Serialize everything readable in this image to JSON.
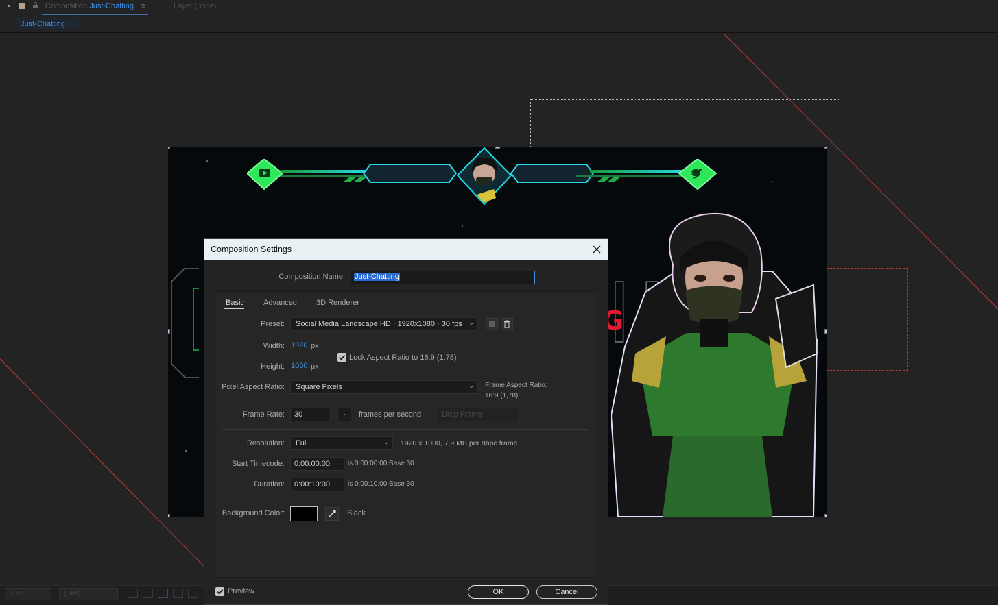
{
  "panel": {
    "close_glyph": "×",
    "comp_prefix": "Composition",
    "comp_name": "Just-Chatting",
    "menu_glyph": "≡",
    "layer_tab": "Layer (none)",
    "comp_chip": "Just-Chatting"
  },
  "viewer": {
    "zoom": "50%",
    "resolution": "(Half)"
  },
  "dialog": {
    "title": "Composition Settings",
    "name_label": "Composition Name:",
    "name_value": "Just-Chatting",
    "tabs": [
      "Basic",
      "Advanced",
      "3D Renderer"
    ],
    "preset_label": "Preset:",
    "preset_value": "Social Media Landscape HD  ·  1920x1080 · 30 fps",
    "width_label": "Width:",
    "width_value": "1920",
    "width_unit": "px",
    "height_label": "Height:",
    "height_value": "1080",
    "height_unit": "px",
    "lock_label": "Lock Aspect Ratio to 16:9 (1,78)",
    "lock_checked": true,
    "par_label": "Pixel Aspect Ratio:",
    "par_value": "Square Pixels",
    "far_label": "Frame Aspect Ratio:",
    "far_value": "16:9 (1,78)",
    "fps_label": "Frame Rate:",
    "fps_value": "30",
    "fps_unit": "frames per second",
    "drop_frame": "Drop Frame",
    "res_label": "Resolution:",
    "res_value": "Full",
    "res_info": "1920 x 1080, 7,9 MB per 8bpc frame",
    "start_label": "Start Timecode:",
    "start_value": "0:00:00:00",
    "start_info": "is 0:00:00:00  Base 30",
    "dur_label": "Duration:",
    "dur_value": "0:00:10:00",
    "dur_info": "is 0:00:10:00  Base 30",
    "bg_label": "Background Color:",
    "bg_name": "Black",
    "bg_color": "#000000",
    "preview_label": "Preview",
    "preview_checked": true,
    "ok_label": "OK",
    "cancel_label": "Cancel"
  },
  "colors": {
    "accent": "#3f8ee0",
    "hud_green": "#2ee85a",
    "hud_cyan": "#27d9e8",
    "brand_red": "#e01b2f"
  }
}
